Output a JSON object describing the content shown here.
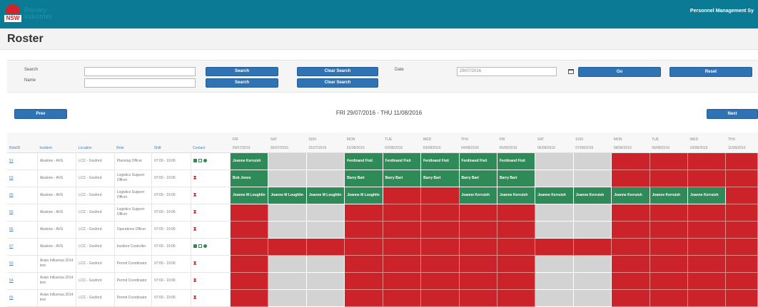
{
  "header": {
    "logo_abbr": "NSW",
    "logo_text_1": "Primary",
    "logo_text_2": "Industries",
    "app_title": "Personnel Management Sy"
  },
  "page_title": "Roster",
  "search": {
    "search_label": "Search",
    "name_label": "Name",
    "search_value": "",
    "name_value": "",
    "search_button_1": "Search",
    "search_button_2": "Search",
    "clear_search_1": "Clear Search",
    "clear_search_2": "Clear Search",
    "date_label": "Date",
    "date_value": "29/07/2016",
    "go_button": "Go",
    "reset_button": "Reset"
  },
  "nav": {
    "prev": "Prev",
    "next": "Next",
    "range": "FRI 29/07/2016 - THU 11/08/2016"
  },
  "columns": {
    "roleid": "RoleID",
    "incident": "Incident",
    "location": "Location",
    "role": "Role",
    "shift": "Shift",
    "contact": "Contact"
  },
  "days": [
    {
      "day": "FRI",
      "date": "29/07/2016"
    },
    {
      "day": "SAT",
      "date": "30/07/2016"
    },
    {
      "day": "SUN",
      "date": "31/07/2016"
    },
    {
      "day": "MON",
      "date": "01/08/2016"
    },
    {
      "day": "TUE",
      "date": "02/08/2016"
    },
    {
      "day": "WED",
      "date": "03/08/2016"
    },
    {
      "day": "THU",
      "date": "04/08/2016"
    },
    {
      "day": "FRI",
      "date": "05/08/2016"
    },
    {
      "day": "SAT",
      "date": "06/08/2016"
    },
    {
      "day": "SUN",
      "date": "07/08/2016"
    },
    {
      "day": "MON",
      "date": "08/08/2016"
    },
    {
      "day": "TUE",
      "date": "09/08/2016"
    },
    {
      "day": "WED",
      "date": "10/08/2016"
    },
    {
      "day": "THU",
      "date": "11/08/2016"
    }
  ],
  "rows": [
    {
      "id": "51",
      "incident": "Abalone - AVG",
      "location": "LCC - Gosford",
      "role": "Planning Officer",
      "shift": "07:00 - 19:00",
      "contact": [
        "green",
        "doc",
        "circle"
      ],
      "cells": [
        [
          "g",
          "Joanne Kerruish"
        ],
        [
          "x",
          ""
        ],
        [
          "x",
          ""
        ],
        [
          "g",
          "Ferdinand Fisit"
        ],
        [
          "g",
          "Ferdinand Fisit"
        ],
        [
          "g",
          "Ferdinand Fisit"
        ],
        [
          "g",
          "Ferdinand Fisit"
        ],
        [
          "g",
          "Ferdinand Fisit"
        ],
        [
          "x",
          ""
        ],
        [
          "x",
          ""
        ],
        [
          "r",
          ""
        ],
        [
          "r",
          ""
        ],
        [
          "r",
          ""
        ],
        [
          "r",
          ""
        ]
      ]
    },
    {
      "id": "53",
      "incident": "Abalone - AVG",
      "location": "LCC - Gosford",
      "role": "Logistics Support Officer",
      "shift": "07:00 - 19:00",
      "contact": [
        "red"
      ],
      "cells": [
        [
          "g",
          "Bob Jones"
        ],
        [
          "x",
          ""
        ],
        [
          "x",
          ""
        ],
        [
          "g",
          "Barry Bart"
        ],
        [
          "g",
          "Barry Bart"
        ],
        [
          "g",
          "Barry Bart"
        ],
        [
          "g",
          "Barry Bart"
        ],
        [
          "g",
          "Barry Bart"
        ],
        [
          "x",
          ""
        ],
        [
          "x",
          ""
        ],
        [
          "r",
          ""
        ],
        [
          "r",
          ""
        ],
        [
          "r",
          ""
        ],
        [
          "r",
          ""
        ]
      ]
    },
    {
      "id": "55",
      "incident": "Abalone - AVG",
      "location": "LCC - Gosford",
      "role": "Logistics Support Officer",
      "shift": "07:00 - 19:00",
      "contact": [
        "red"
      ],
      "cells": [
        [
          "g",
          "Joanne M Loughlin"
        ],
        [
          "g",
          "Joanne M Loughlin"
        ],
        [
          "g",
          "Joanne M Loughlin"
        ],
        [
          "g",
          "Joanne M Loughlin"
        ],
        [
          "r",
          ""
        ],
        [
          "r",
          ""
        ],
        [
          "g",
          "Joanne Kerruish"
        ],
        [
          "g",
          "Joanne Kerruish"
        ],
        [
          "g",
          "Joanne Kerruish"
        ],
        [
          "g",
          "Joanne Kerruish"
        ],
        [
          "g",
          "Joanne Kerruish"
        ],
        [
          "g",
          "Joanne Kerruish"
        ],
        [
          "g",
          "Joanne Kerruish"
        ],
        [
          "r",
          ""
        ]
      ]
    },
    {
      "id": "50",
      "incident": "Abalone - AVG",
      "location": "LCC - Gosford",
      "role": "Logistics Support Officer",
      "shift": "07:00 - 19:00",
      "contact": [
        "red"
      ],
      "cells": [
        [
          "r",
          ""
        ],
        [
          "x",
          ""
        ],
        [
          "x",
          ""
        ],
        [
          "r",
          ""
        ],
        [
          "r",
          ""
        ],
        [
          "r",
          ""
        ],
        [
          "r",
          ""
        ],
        [
          "r",
          ""
        ],
        [
          "x",
          ""
        ],
        [
          "x",
          ""
        ],
        [
          "r",
          ""
        ],
        [
          "r",
          ""
        ],
        [
          "r",
          ""
        ],
        [
          "r",
          ""
        ]
      ]
    },
    {
      "id": "56",
      "incident": "Abalone - AVG",
      "location": "LCC - Gosford",
      "role": "Operations Officer",
      "shift": "07:00 - 19:00",
      "contact": [
        "red"
      ],
      "cells": [
        [
          "r",
          ""
        ],
        [
          "x",
          ""
        ],
        [
          "x",
          ""
        ],
        [
          "r",
          ""
        ],
        [
          "r",
          ""
        ],
        [
          "r",
          ""
        ],
        [
          "r",
          ""
        ],
        [
          "r",
          ""
        ],
        [
          "x",
          ""
        ],
        [
          "x",
          ""
        ],
        [
          "r",
          ""
        ],
        [
          "r",
          ""
        ],
        [
          "r",
          ""
        ],
        [
          "r",
          ""
        ]
      ]
    },
    {
      "id": "57",
      "incident": "Abalone - AVG",
      "location": "LCC - Gosford",
      "role": "Incident Controller",
      "shift": "07:00 - 19:00",
      "contact": [
        "green",
        "doc",
        "circle"
      ],
      "cells": [
        [
          "r",
          ""
        ],
        [
          "r",
          ""
        ],
        [
          "r",
          ""
        ],
        [
          "r",
          ""
        ],
        [
          "r",
          ""
        ],
        [
          "r",
          ""
        ],
        [
          "r",
          ""
        ],
        [
          "r",
          ""
        ],
        [
          "r",
          ""
        ],
        [
          "r",
          ""
        ],
        [
          "r",
          ""
        ],
        [
          "r",
          ""
        ],
        [
          "r",
          ""
        ],
        [
          "r",
          ""
        ]
      ]
    },
    {
      "id": "53",
      "incident": "Avian Influenza 2014 test",
      "location": "LCC - Gosford",
      "role": "Permit Coordinator",
      "shift": "07:00 - 19:00",
      "contact": [
        "red"
      ],
      "cells": [
        [
          "r",
          ""
        ],
        [
          "x",
          ""
        ],
        [
          "x",
          ""
        ],
        [
          "r",
          ""
        ],
        [
          "r",
          ""
        ],
        [
          "r",
          ""
        ],
        [
          "r",
          ""
        ],
        [
          "r",
          ""
        ],
        [
          "x",
          ""
        ],
        [
          "x",
          ""
        ],
        [
          "r",
          ""
        ],
        [
          "r",
          ""
        ],
        [
          "r",
          ""
        ],
        [
          "r",
          ""
        ]
      ]
    },
    {
      "id": "54",
      "incident": "Avian Influenza 2014 test",
      "location": "LCC - Gosford",
      "role": "Permit Coordinator",
      "shift": "07:00 - 19:00",
      "contact": [
        "red"
      ],
      "cells": [
        [
          "r",
          ""
        ],
        [
          "x",
          ""
        ],
        [
          "x",
          ""
        ],
        [
          "r",
          ""
        ],
        [
          "r",
          ""
        ],
        [
          "r",
          ""
        ],
        [
          "r",
          ""
        ],
        [
          "r",
          ""
        ],
        [
          "x",
          ""
        ],
        [
          "x",
          ""
        ],
        [
          "r",
          ""
        ],
        [
          "r",
          ""
        ],
        [
          "r",
          ""
        ],
        [
          "r",
          ""
        ]
      ]
    },
    {
      "id": "55",
      "incident": "Avian Influenza 2014 test",
      "location": "LCC - Gosford",
      "role": "Permit Coordinator",
      "shift": "07:00 - 19:00",
      "contact": [
        "red"
      ],
      "cells": [
        [
          "r",
          ""
        ],
        [
          "x",
          ""
        ],
        [
          "x",
          ""
        ],
        [
          "r",
          ""
        ],
        [
          "r",
          ""
        ],
        [
          "r",
          ""
        ],
        [
          "r",
          ""
        ],
        [
          "r",
          ""
        ],
        [
          "x",
          ""
        ],
        [
          "x",
          ""
        ],
        [
          "r",
          ""
        ],
        [
          "r",
          ""
        ],
        [
          "r",
          ""
        ],
        [
          "r",
          ""
        ]
      ]
    }
  ],
  "colors": {
    "header_bg": "#0b7a94",
    "button": "#2f73b5",
    "assigned": "#2e8b57",
    "unfilled": "#cc2229",
    "not_required": "#d3d3d3"
  }
}
